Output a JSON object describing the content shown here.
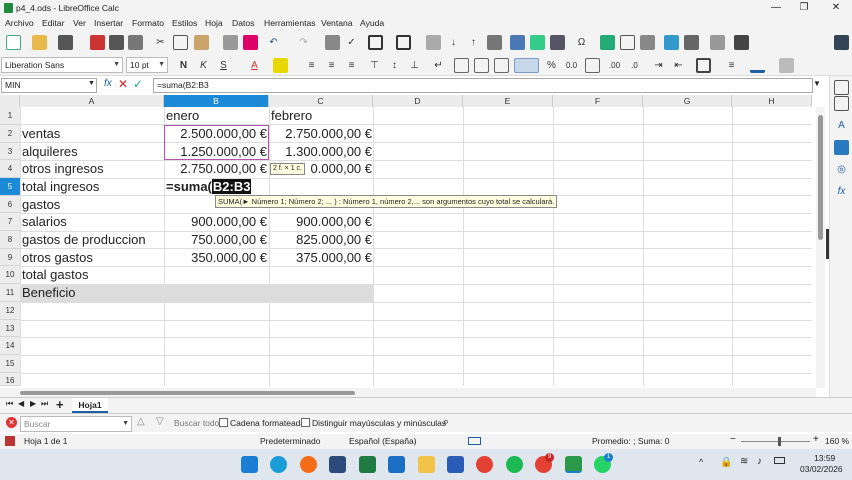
{
  "window": {
    "title": "p4_4.ods - LibreOffice Calc",
    "minimize": "—",
    "maximize": "❐",
    "close": "✕"
  },
  "menu": [
    "Archivo",
    "Editar",
    "Ver",
    "Insertar",
    "Formato",
    "Estilos",
    "Hoja",
    "Datos",
    "Herramientas",
    "Ventana",
    "Ayuda"
  ],
  "toolbar2": {
    "font_name": "Liberation Sans",
    "font_size": "10 pt"
  },
  "formula_bar": {
    "name_box": "MIN",
    "formula": "=suma(B2:B3",
    "fx_icon": "fx",
    "sum_icon": "Σ",
    "cancel": "✕",
    "accept": "✓"
  },
  "columns": [
    {
      "label": "A"
    },
    {
      "label": "B"
    },
    {
      "label": "C"
    },
    {
      "label": "D"
    },
    {
      "label": "E"
    },
    {
      "label": "F"
    },
    {
      "label": "G"
    },
    {
      "label": "H"
    }
  ],
  "rows": [
    "1",
    "2",
    "3",
    "4",
    "5",
    "6",
    "7",
    "8",
    "9",
    "10",
    "11",
    "12",
    "13",
    "14",
    "15",
    "16"
  ],
  "cells": {
    "b1": "enero",
    "c1": "febrero",
    "a2": "ventas",
    "b2": "2.500.000,00 €",
    "c2": "2.750.000,00 €",
    "a3": "alquileres",
    "b3": "1.250.000,00 €",
    "c3": "1.300.000,00 €",
    "a4": "otros ingresos",
    "b4": "2.750.000,00 €",
    "c4": "0.000,00 €",
    "a5": "total ingresos",
    "b5_prefix": "=suma(",
    "b5_ref": "B2:B3",
    "a6": "gastos",
    "a7": "salarios",
    "b7": "900.000,00 €",
    "c7": "900.000,00 €",
    "a8": "gastos de produccion",
    "b8": "750.000,00 €",
    "c8": "825.000,00 €",
    "a9": "otros gastos",
    "b9": "350.000,00 €",
    "c9": "375.000,00 €",
    "a10": "total gastos",
    "a11": "Beneficio"
  },
  "range_tip": "2 f. × 1 c.",
  "function_tip": "SUMA(► Número 1; Número 2; ... ) : Número 1, número 2,... son argumentos cuyo total se calculará.",
  "sheet_tabs": {
    "add": "+",
    "active": "Hoja1"
  },
  "find_bar": {
    "placeholder": "Buscar",
    "find_all": "Buscar todo",
    "formatted": "Cadena formateada",
    "match_case": "Distinguir mayúsculas y minúsculas"
  },
  "status": {
    "sheet": "Hoja 1 de 1",
    "style": "Predeterminado",
    "language": "Español (España)",
    "summary": "Promedio: ; Suma: 0",
    "zoom": "160 %",
    "minus": "−",
    "plus": "+"
  },
  "taskbar": {
    "time": "13:59",
    "date": "03/02/2026",
    "badge_chrome": "9",
    "badge_whatsapp": "1"
  }
}
